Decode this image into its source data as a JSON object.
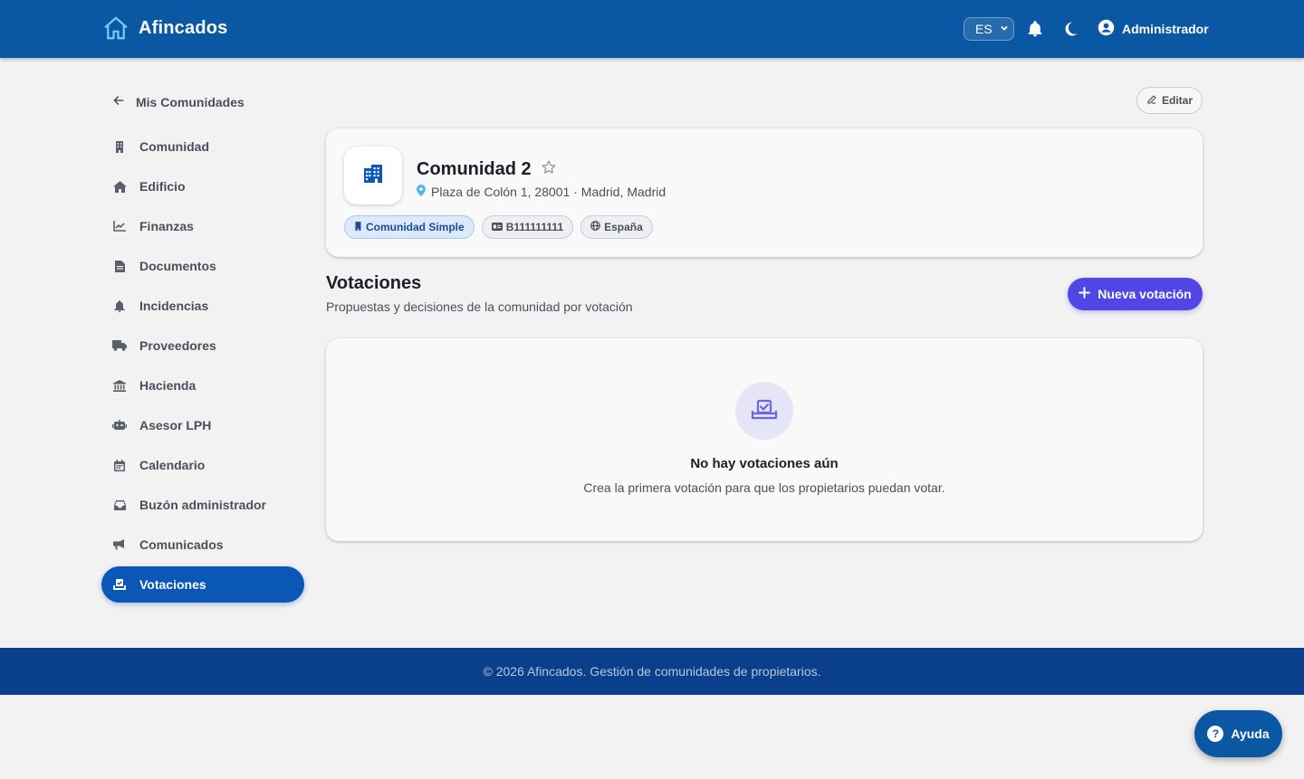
{
  "header": {
    "brand": "Afincados",
    "language": "ES",
    "user": "Administrador"
  },
  "sidebar": {
    "back_label": "Mis Comunidades",
    "items": [
      {
        "label": "Comunidad",
        "icon": "building-icon"
      },
      {
        "label": "Edificio",
        "icon": "home-icon"
      },
      {
        "label": "Finanzas",
        "icon": "chart-line-icon"
      },
      {
        "label": "Documentos",
        "icon": "document-icon"
      },
      {
        "label": "Incidencias",
        "icon": "bell-icon"
      },
      {
        "label": "Proveedores",
        "icon": "truck-icon"
      },
      {
        "label": "Hacienda",
        "icon": "bank-icon"
      },
      {
        "label": "Asesor LPH",
        "icon": "robot-icon"
      },
      {
        "label": "Calendario",
        "icon": "calendar-icon"
      },
      {
        "label": "Buzón administrador",
        "icon": "inbox-icon"
      },
      {
        "label": "Comunicados",
        "icon": "megaphone-icon"
      },
      {
        "label": "Votaciones",
        "icon": "ballot-icon",
        "active": true
      }
    ]
  },
  "actions": {
    "edit_label": "Editar"
  },
  "community": {
    "name": "Comunidad 2",
    "address": "Plaza de Colón 1, 28001 · Madrid, Madrid",
    "chips": {
      "type": "Comunidad Simple",
      "cif": "B111111111",
      "country": "España"
    }
  },
  "section": {
    "title": "Votaciones",
    "subtitle": "Propuestas y decisiones de la comunidad por votación",
    "new_button": "Nueva votación"
  },
  "empty_state": {
    "title": "No hay votaciones aún",
    "subtitle": "Crea la primera votación para que los propietarios puedan votar."
  },
  "footer": {
    "text": "© 2026 Afincados. Gestión de comunidades de propietarios."
  },
  "help": {
    "label": "Ayuda"
  },
  "colors": {
    "header_bg": "#0a57a4",
    "active_nav": "#0a57b8",
    "primary_button": "#4f46e5",
    "footer_bg": "#0a3f8c",
    "chip_primary_bg": "#dbe9fb"
  }
}
